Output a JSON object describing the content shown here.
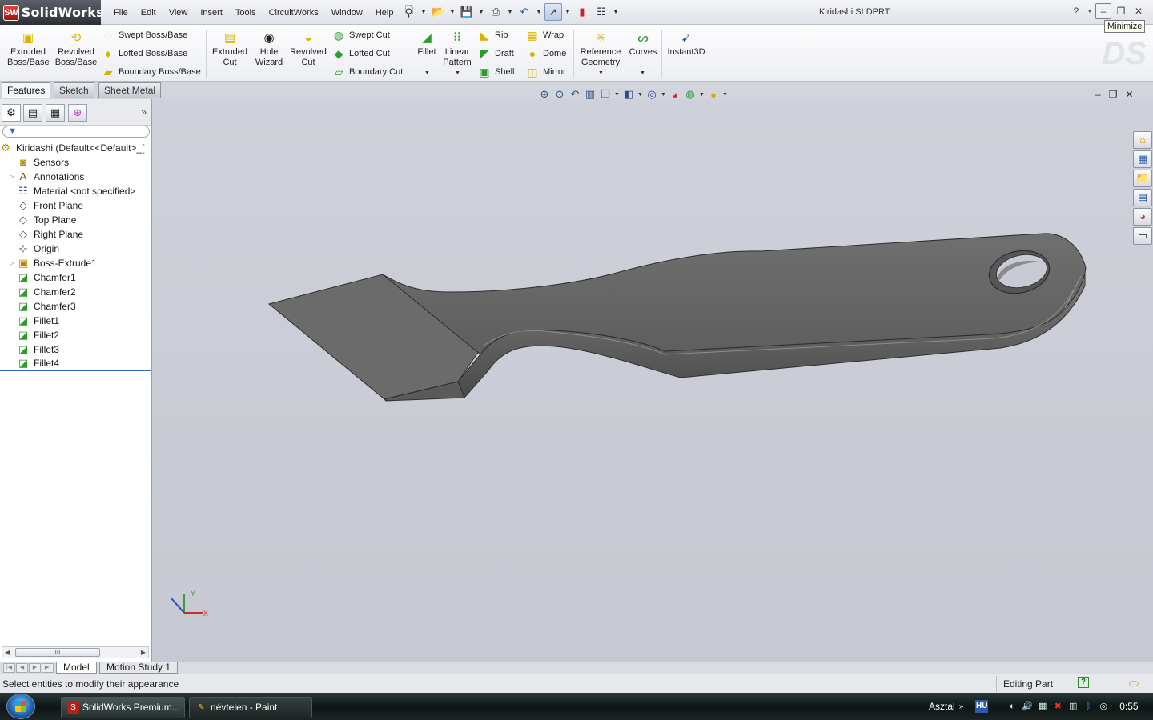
{
  "app": {
    "logo_text": "SolidWorks",
    "logo_mark": "SW",
    "document_title": "Kiridashi.SLDPRT",
    "tooltip": "Minimize",
    "help": "?"
  },
  "menus": [
    "File",
    "Edit",
    "View",
    "Insert",
    "Tools",
    "CircuitWorks",
    "Window",
    "Help"
  ],
  "ribbon": {
    "extruded_boss": [
      "Extruded",
      "Boss/Base"
    ],
    "revolved_boss": [
      "Revolved",
      "Boss/Base"
    ],
    "swept_boss": "Swept Boss/Base",
    "lofted_boss": "Lofted Boss/Base",
    "boundary_boss": "Boundary Boss/Base",
    "extruded_cut": [
      "Extruded",
      "Cut"
    ],
    "hole_wizard": [
      "Hole",
      "Wizard"
    ],
    "revolved_cut": [
      "Revolved",
      "Cut"
    ],
    "swept_cut": "Swept Cut",
    "lofted_cut": "Lofted Cut",
    "boundary_cut": "Boundary Cut",
    "fillet": "Fillet",
    "linear_pattern": [
      "Linear",
      "Pattern"
    ],
    "rib": "Rib",
    "draft": "Draft",
    "shell": "Shell",
    "wrap": "Wrap",
    "dome": "Dome",
    "mirror": "Mirror",
    "reference_geometry": [
      "Reference",
      "Geometry"
    ],
    "curves": "Curves",
    "instant3d": "Instant3D"
  },
  "cm_tabs": [
    "Features",
    "Sketch",
    "Sheet Metal"
  ],
  "tree": [
    {
      "label": "Kiridashi  (Default<<Default>_[",
      "icon": "part-icon"
    },
    {
      "label": "Sensors",
      "icon": "sensor-icon"
    },
    {
      "label": "Annotations",
      "icon": "annotation-icon"
    },
    {
      "label": "Material <not specified>",
      "icon": "material-icon"
    },
    {
      "label": "Front Plane",
      "icon": "plane-icon"
    },
    {
      "label": "Top Plane",
      "icon": "plane-icon"
    },
    {
      "label": "Right Plane",
      "icon": "plane-icon"
    },
    {
      "label": "Origin",
      "icon": "origin-icon"
    },
    {
      "label": "Boss-Extrude1",
      "icon": "extrude-icon"
    },
    {
      "label": "Chamfer1",
      "icon": "chamfer-icon"
    },
    {
      "label": "Chamfer2",
      "icon": "chamfer-icon"
    },
    {
      "label": "Chamfer3",
      "icon": "chamfer-icon"
    },
    {
      "label": "Fillet1",
      "icon": "fillet-icon"
    },
    {
      "label": "Fillet2",
      "icon": "fillet-icon"
    },
    {
      "label": "Fillet3",
      "icon": "fillet-icon"
    },
    {
      "label": "Fillet4",
      "icon": "fillet-icon"
    }
  ],
  "triad": {
    "x": "X",
    "y": "Y"
  },
  "bottom_tabs": [
    "Model",
    "Motion Study 1"
  ],
  "status": {
    "message": "Select entities to modify their appearance",
    "mode": "Editing Part",
    "help_icon": "?"
  },
  "taskbar": {
    "tasks": [
      "SolidWorks Premium...",
      "névtelen - Paint"
    ],
    "desktop": "Asztal",
    "language": "HU",
    "clock": "0:55"
  },
  "colors": {
    "part_face": "#6a6a6a",
    "viewport_bg": "#c9ccd4",
    "accent": "#2f64c8"
  }
}
